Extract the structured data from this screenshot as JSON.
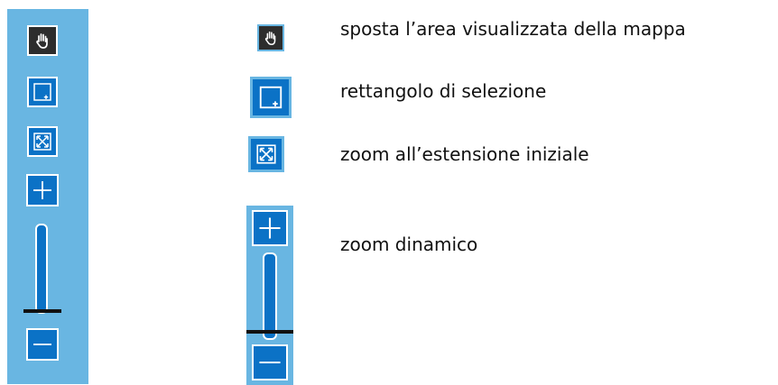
{
  "colors": {
    "toolbar_bg": "#69b6e2",
    "button_bg": "#0b72c6",
    "pan_button_bg": "#2d2d2d",
    "icon_fg": "#ffffff",
    "slider_thumb": "#111111"
  },
  "toolbar": {
    "icons": {
      "pan": "hand-icon",
      "select": "selection-rectangle-icon",
      "extent": "full-extent-icon",
      "zoom_in": "plus-icon",
      "zoom_out": "minus-icon"
    }
  },
  "zoom_slider": {
    "level_fraction": 0.15
  },
  "legend": {
    "items": [
      {
        "icon": "hand-icon",
        "label": "sposta l’area visualizzata della mappa"
      },
      {
        "icon": "selection-rectangle-icon",
        "label": "rettangolo di selezione"
      },
      {
        "icon": "full-extent-icon",
        "label": "zoom all’estensione iniziale"
      },
      {
        "icon": "zoom-slider-icon",
        "label": "zoom dinamico"
      }
    ]
  }
}
